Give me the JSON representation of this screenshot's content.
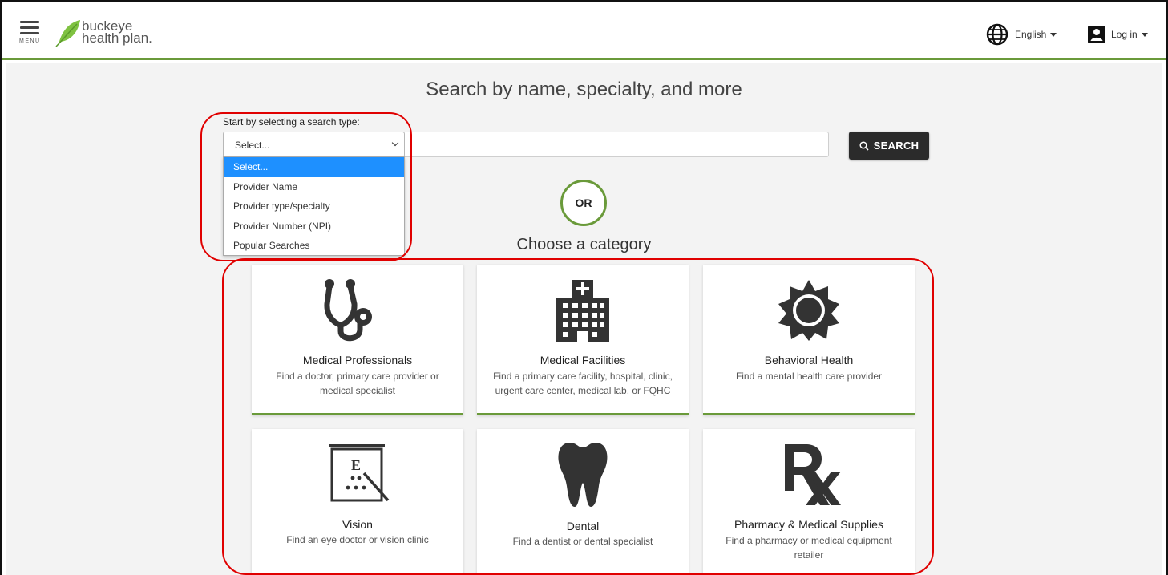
{
  "header": {
    "menu_label": "MENU",
    "logo_line1": "buckeye",
    "logo_line2": "health plan.",
    "language": "English",
    "login": "Log in"
  },
  "main": {
    "title": "Search by name, specialty, and more",
    "select_label": "Start by selecting a search type:",
    "select_value": "Select...",
    "search_button": "SEARCH",
    "dropdown_options": [
      "Select...",
      "Provider Name",
      "Provider type/specialty",
      "Provider Number (NPI)",
      "Popular Searches"
    ],
    "or_text": "OR",
    "category_heading": "Choose a category"
  },
  "categories": [
    {
      "title": "Medical Professionals",
      "desc": "Find a doctor, primary care provider or medical specialist",
      "icon": "stethoscope-icon"
    },
    {
      "title": "Medical Facilities",
      "desc": "Find a primary care facility, hospital, clinic, urgent care center, medical lab, or FQHC",
      "icon": "hospital-icon"
    },
    {
      "title": "Behavioral Health",
      "desc": "Find a mental health care provider",
      "icon": "sun-icon"
    },
    {
      "title": "Vision",
      "desc": "Find an eye doctor or vision clinic",
      "icon": "eye-chart-icon"
    },
    {
      "title": "Dental",
      "desc": "Find a dentist or dental specialist",
      "icon": "tooth-icon"
    },
    {
      "title": "Pharmacy & Medical Supplies",
      "desc": "Find a pharmacy or medical equipment retailer",
      "icon": "rx-icon"
    }
  ],
  "colors": {
    "accent_green": "#6a9a3a",
    "highlight_blue": "#1e90ff",
    "button_dark": "#2b2b2b",
    "annotation_red": "#e00000"
  }
}
